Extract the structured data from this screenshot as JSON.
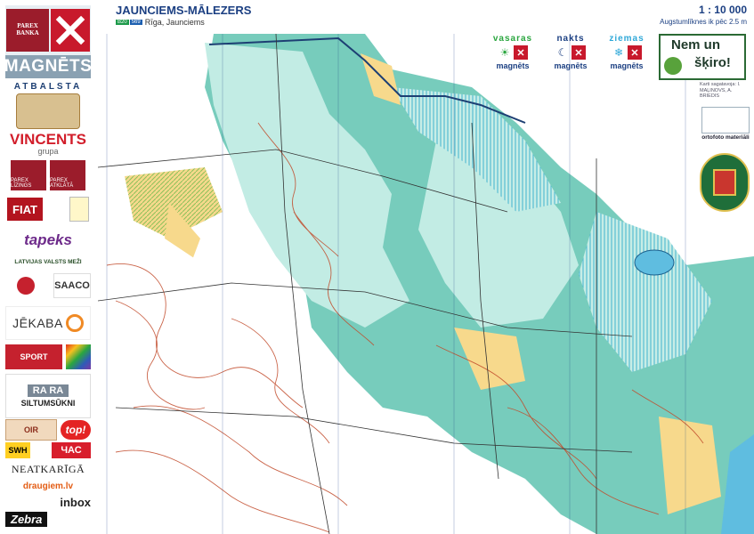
{
  "header": {
    "title": "JAUNCIEMS-MĀLEZERS",
    "location": "Rīga, Jaunciems",
    "tag1": "B20",
    "tag2": "569",
    "scale": "1 : 10 000",
    "contour_interval": "Augstumlīknes ik pēc 2.5 m"
  },
  "sidebar": {
    "parex_text": "PAREX BANKA",
    "magnets": "MAGNĒTS",
    "atbalsta": "ATBALSTA",
    "vincents": "VINCENTS",
    "vincents_sub": "grupa",
    "parex_left": "PAREX LĪZINGS",
    "parex_right": "PAREX ATKLĀTĀ",
    "fiat": "FIAT",
    "tapeks": "tapeks",
    "lvm": "LATVIJAS VALSTS MEŽI",
    "saaco": "SAACO",
    "jekaba": "JĒKABA",
    "sport": "SPORT",
    "rara": "RA RA",
    "rara_text": "SILTUMSŪKNI",
    "oir": "OIR",
    "top": "top!",
    "swh": "SWH",
    "chas": "ЧАС",
    "neatkariga": "NEATKARĪGĀ",
    "draugiem": "draugiem.lv",
    "inbox": "inbox",
    "zebra": "Zebra"
  },
  "series": [
    {
      "name": "vasaras",
      "color": "#2aa63f",
      "symbol": "☀",
      "brand": "magnēts"
    },
    {
      "name": "nakts",
      "color": "#1b3f82",
      "symbol": "☾",
      "brand": "magnēts"
    },
    {
      "name": "ziemas",
      "color": "#2fa8d8",
      "symbol": "❄",
      "brand": "magnēts"
    }
  ],
  "nem_un_skiro": {
    "line1": "Nem un",
    "line2": "šķiro!"
  },
  "right_notes": {
    "top": "Karti sagatavoja: I. MAĻINOVS, A. BRIEDIS",
    "ortofoto": "ortofoto materiāli"
  },
  "colors": {
    "map_bg": "#ffffff",
    "forest_teal": "#5fc3b0",
    "forest_light": "#c2ece4",
    "contour": "#c14a2a",
    "open_yellow": "#f7d98c",
    "marsh_blue": "#1ea6c8",
    "water": "#5fbde0",
    "title_blue": "#1b3f82"
  }
}
